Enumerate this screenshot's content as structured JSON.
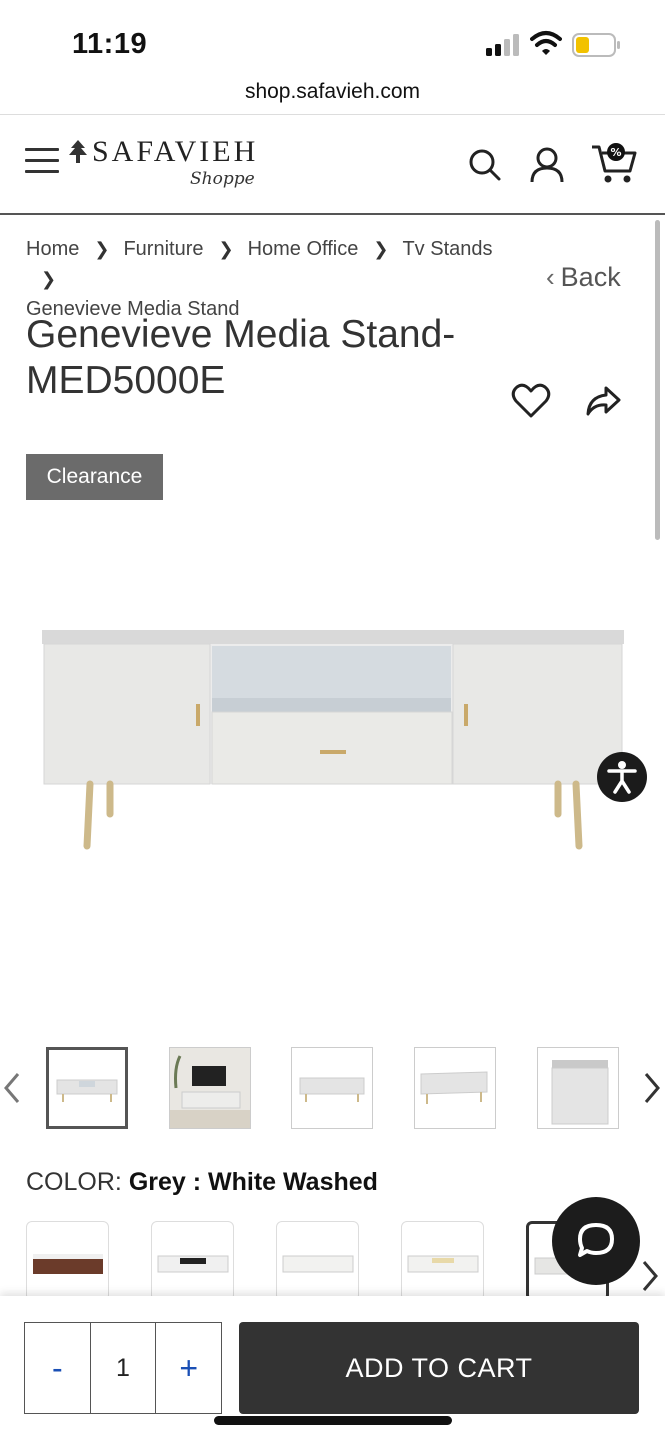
{
  "status_bar": {
    "time": "11:19"
  },
  "browser": {
    "url": "shop.safavieh.com"
  },
  "header": {
    "brand": "SAFAVIEH",
    "brand_sub": "Shoppe",
    "cart_badge": "%"
  },
  "breadcrumb": [
    "Home",
    "Furniture",
    "Home Office",
    "Tv Stands",
    "Genevieve Media Stand"
  ],
  "back_label": "Back",
  "product": {
    "title_line1": "Genevieve Media Stand-",
    "title_line2": "MED5000E",
    "badge": "Clearance",
    "color_label": "COLOR:",
    "color_value": "Grey : White Washed"
  },
  "quantity": {
    "minus": "-",
    "value": "1",
    "plus": "+"
  },
  "add_to_cart": "ADD TO CART",
  "colors": {
    "accent_blue": "#1a4fb5",
    "dark_button": "#333333",
    "badge_grey": "#6b6b6b"
  }
}
